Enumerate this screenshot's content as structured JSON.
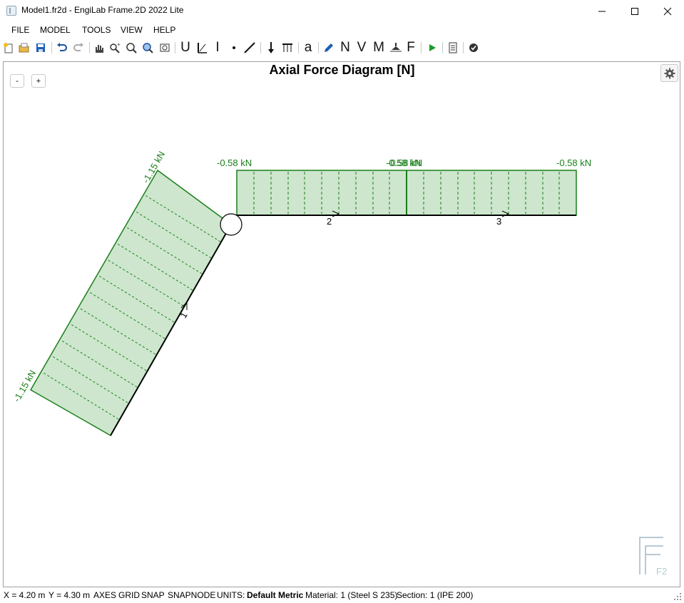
{
  "window": {
    "title": "Model1.fr2d - EngiLab Frame.2D 2022 Lite",
    "minimize_glyph": "—",
    "maximize_glyph": "☐",
    "close_glyph": "✕"
  },
  "menu": {
    "items": [
      "FILE",
      "MODEL",
      "TOOLS",
      "VIEW",
      "HELP"
    ]
  },
  "toolbar": {
    "icons": [
      "new-icon",
      "open-icon",
      "save-icon",
      "undo-icon",
      "redo-icon",
      "pan-icon",
      "zoom-in-icon",
      "zoom-icon",
      "zoom-extents-icon",
      "zoom-window-icon",
      "beam-icon",
      "hinge-icon",
      "section-icon",
      "node-icon",
      "line-icon",
      "point-load-icon",
      "distributed-load-icon",
      "label-icon",
      "edit-icon",
      "axial-icon",
      "shear-icon",
      "moment-icon",
      "reactions-icon",
      "force-icon",
      "run-icon",
      "report-icon",
      "check-icon"
    ],
    "letters": {
      "u": "U",
      "i": "I",
      "a": "a",
      "n": "N",
      "v": "V",
      "m": "M",
      "f": "F"
    }
  },
  "canvas": {
    "zoom_out_label": "-",
    "zoom_in_label": "+",
    "diagram_title": "Axial Force Diagram [N]",
    "settings_icon": "gear-icon",
    "diagram_color": "#1a7f1a",
    "fill_color": "#cde6cd",
    "members": [
      {
        "id": "1",
        "start_label": "-1.15 kN",
        "end_label": "-1.15 kN"
      },
      {
        "id": "2",
        "start_label": "-0.58 kN",
        "end_label": "-0.58 kN"
      },
      {
        "id": "3",
        "start_label": "-0.58 kN",
        "end_label": "-0.58 kN"
      }
    ],
    "watermark": "F2"
  },
  "status": {
    "x": "X = 4.20 m",
    "y": "Y = 4.30 m",
    "axes": "AXES",
    "grid": "GRID",
    "snap": "SNAP",
    "snapnode": "SNAPNODE",
    "units_label": "UNITS:",
    "units_value": "Default Metric",
    "material": "Material: 1 (Steel S 235)",
    "section": "Section: 1 (IPE 200)"
  }
}
